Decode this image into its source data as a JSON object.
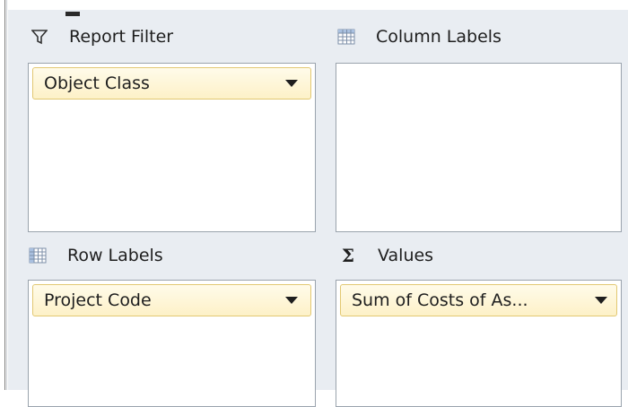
{
  "areas": {
    "report_filter": {
      "title": "Report Filter",
      "icon": "filter-icon",
      "fields": [
        "Object Class"
      ]
    },
    "column_labels": {
      "title": "Column Labels",
      "icon": "column-labels-icon",
      "fields": []
    },
    "row_labels": {
      "title": "Row Labels",
      "icon": "row-labels-icon",
      "fields": [
        "Project Code"
      ]
    },
    "values": {
      "title": "Values",
      "icon": "sigma-icon",
      "fields": [
        "Sum of Costs of As..."
      ]
    }
  },
  "colors": {
    "field_fill": "#fdf1c8",
    "field_border": "#e2c872",
    "panel_bg": "#e9edf2"
  }
}
